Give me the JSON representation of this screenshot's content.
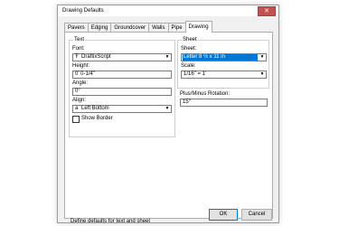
{
  "window": {
    "title": "Drawing Defaults",
    "close_symbol": "✕"
  },
  "tabs": [
    {
      "label": "Pavers",
      "active": false
    },
    {
      "label": "Edging",
      "active": false
    },
    {
      "label": "Groundcover",
      "active": false
    },
    {
      "label": "Walls",
      "active": false
    },
    {
      "label": "Pipe",
      "active": false
    },
    {
      "label": "Drawing",
      "active": true
    }
  ],
  "text_group": {
    "legend": "Text",
    "font_label": "Font:",
    "font_value": "DraftixScript",
    "font_icon": "Ŧ",
    "height_label": "Height:",
    "height_value": "0' 0-1/4\"",
    "angle_label": "Angle:",
    "angle_value": "0°",
    "align_label": "Align:",
    "align_value": "Left Bottom",
    "align_icon": "a",
    "show_border_label": "Show Border"
  },
  "sheet_group": {
    "legend": "Sheet",
    "sheet_label": "Sheet:",
    "sheet_value": "Letter 8 ½ x 11 in",
    "scale_label": "Scale:",
    "scale_value": "1/16\" = 1'",
    "rotation_label": "Plus/Minus Rotation:",
    "rotation_value": "15°"
  },
  "status_text": "Define defaults for text and sheet",
  "buttons": {
    "ok": "OK",
    "cancel": "Cancel"
  },
  "colors": {
    "accent": "#0078d7",
    "close": "#c75050"
  }
}
